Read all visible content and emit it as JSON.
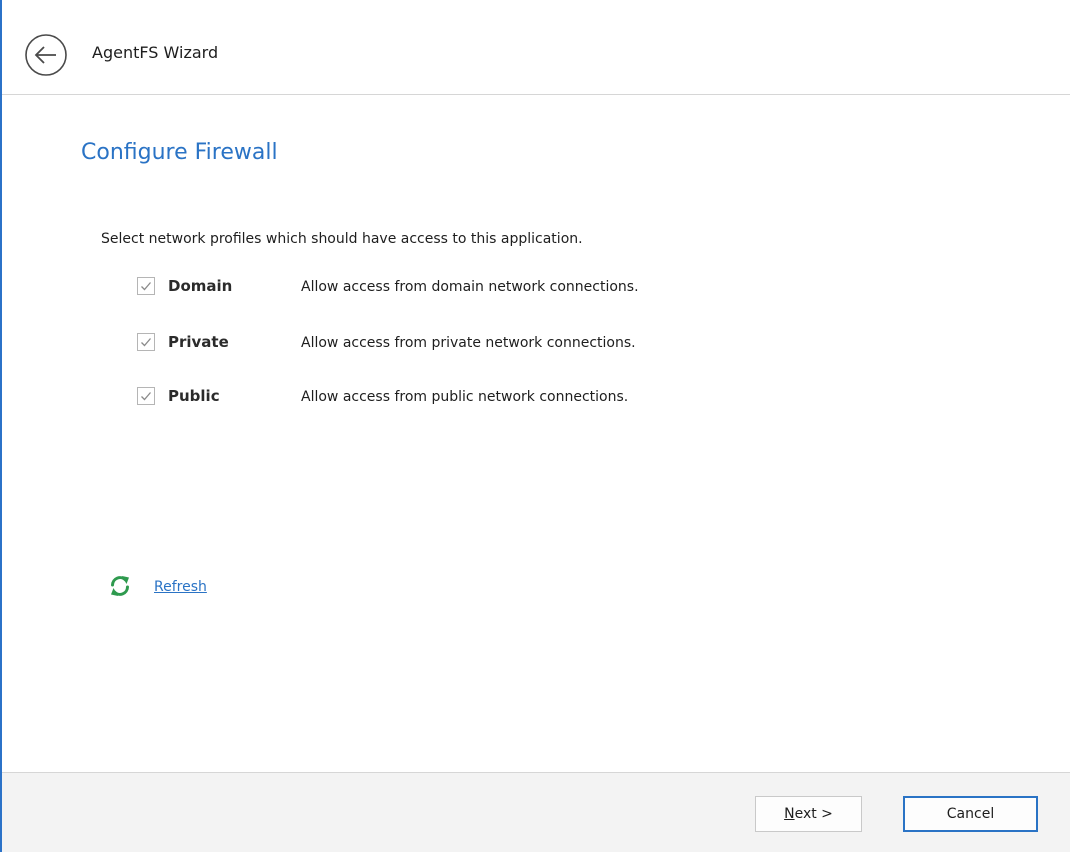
{
  "window": {
    "title": "AgentFS Wizard"
  },
  "page": {
    "title": "Configure Firewall",
    "instructions": "Select network profiles which should have access to this application."
  },
  "profiles": [
    {
      "name": "Domain",
      "description": "Allow access from domain network connections.",
      "checked": true
    },
    {
      "name": "Private",
      "description": "Allow access from private network connections.",
      "checked": true
    },
    {
      "name": "Public",
      "description": "Allow access from public network connections.",
      "checked": true
    }
  ],
  "refresh": {
    "label": "Refresh",
    "icon": "refresh-icon",
    "icon_color": "#2e9a4e"
  },
  "footer": {
    "next_mnemonic": "N",
    "next_rest": "ext >",
    "cancel_label": "Cancel"
  },
  "colors": {
    "accent": "#2a73c5",
    "footer_bg": "#f3f3f3"
  }
}
